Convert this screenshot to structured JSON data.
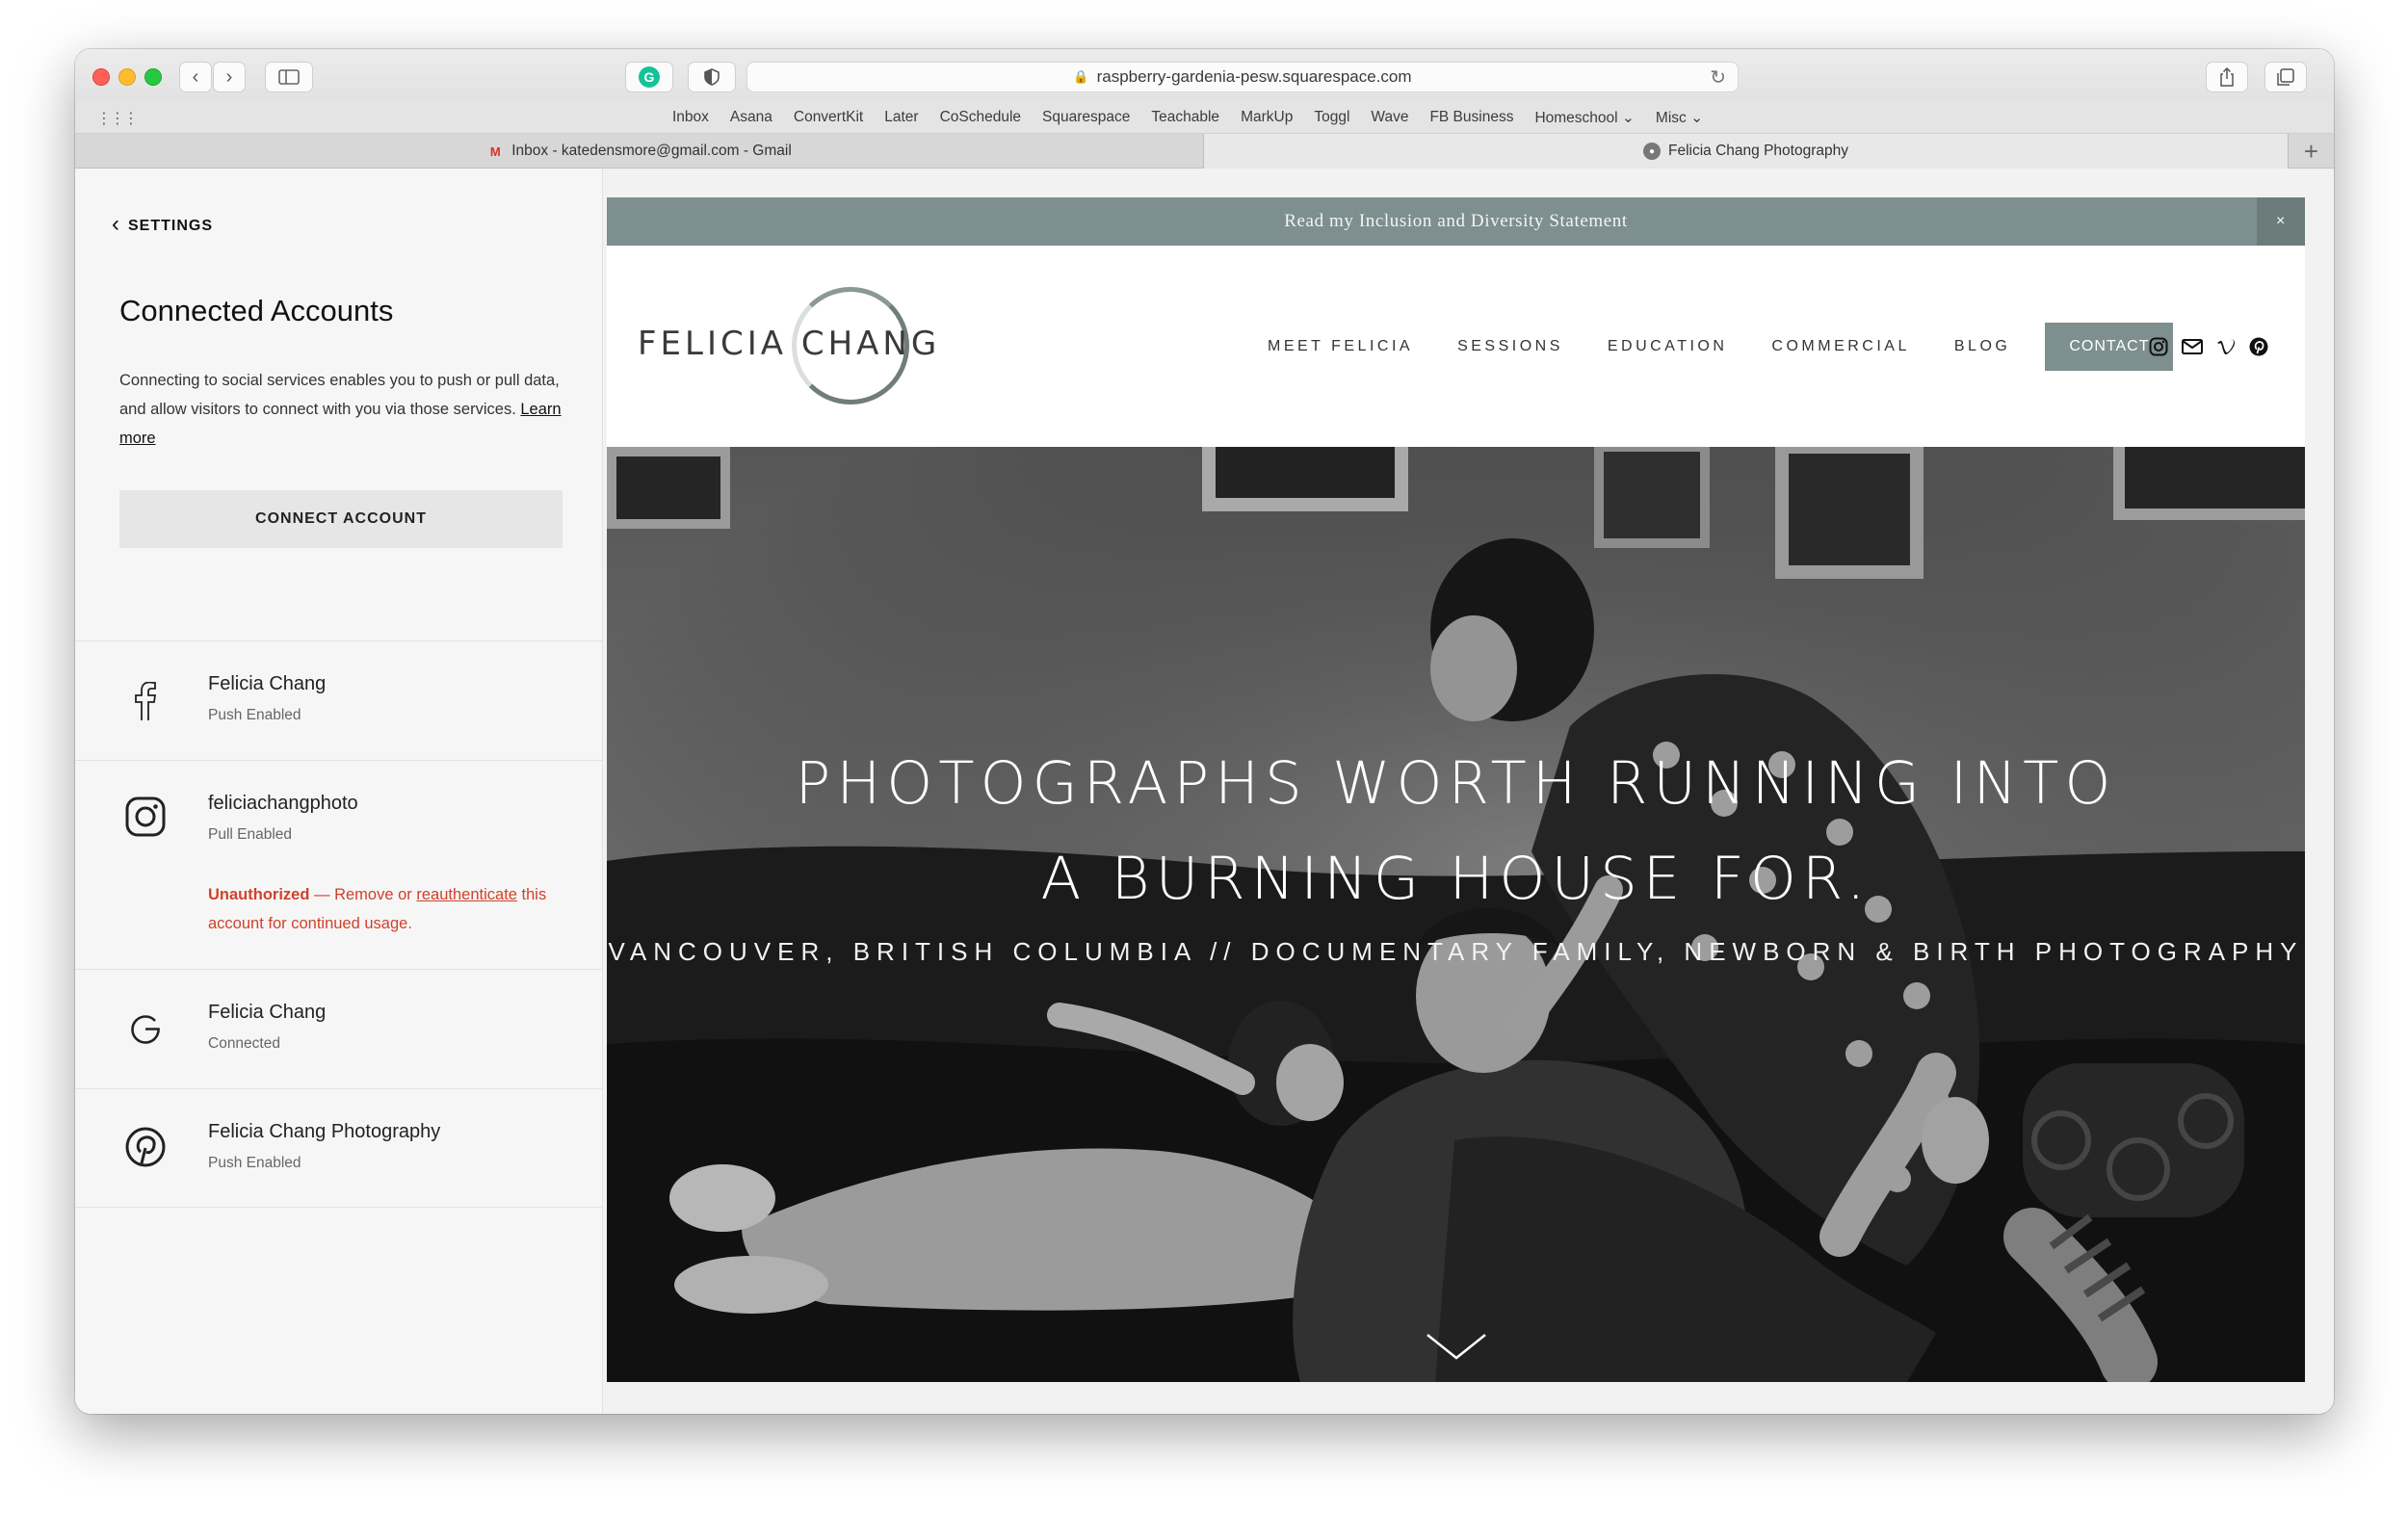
{
  "browser": {
    "url": "raspberry-gardenia-pesw.squarespace.com",
    "bookmarks": [
      "Inbox",
      "Asana",
      "ConvertKit",
      "Later",
      "CoSchedule",
      "Squarespace",
      "Teachable",
      "MarkUp",
      "Toggl",
      "Wave",
      "FB Business",
      "Homeschool ⌄",
      "Misc ⌄"
    ],
    "tabs": [
      {
        "title": "Inbox - katedensmore@gmail.com - Gmail",
        "favicon": "gmail-icon"
      },
      {
        "title": "Felicia Chang Photography",
        "favicon": "site-favicon"
      }
    ]
  },
  "sidebar": {
    "back_label": "SETTINGS",
    "title": "Connected Accounts",
    "description": "Connecting to social services enables you to push or pull data, and allow visitors to connect with you via those services.",
    "learn_more": "Learn more",
    "connect_button": "CONNECT ACCOUNT",
    "accounts": [
      {
        "icon": "facebook-icon",
        "name": "Felicia Chang",
        "status": "Push Enabled"
      },
      {
        "icon": "instagram-icon",
        "name": "feliciachangphoto",
        "status": "Pull Enabled",
        "warning_strong": "Unauthorized",
        "warning_text1": " — Remove or ",
        "warning_link": "reauthenticate",
        "warning_text2": " this account for continued usage."
      },
      {
        "icon": "google-icon",
        "name": "Felicia Chang",
        "status": "Connected"
      },
      {
        "icon": "pinterest-icon",
        "name": "Felicia Chang Photography",
        "status": "Push Enabled"
      }
    ]
  },
  "site": {
    "announcement": "Read my Inclusion and Diversity Statement",
    "close": "×",
    "logo_text": "FELICIA CHANG",
    "nav": [
      "MEET FELICIA",
      "SESSIONS",
      "EDUCATION",
      "COMMERCIAL",
      "BLOG"
    ],
    "contact": "CONTACT",
    "social_icons": [
      "instagram-icon",
      "mail-icon",
      "vimeo-icon",
      "pinterest-icon"
    ],
    "hero_line1": "PHOTOGRAPHS WORTH RUNNING INTO",
    "hero_line2": "A BURNING HOUSE FOR.",
    "hero_sub": "VANCOUVER, BRITISH COLUMBIA  // DOCUMENTARY FAMILY, NEWBORN & BIRTH PHOTOGRAPHY"
  },
  "colors": {
    "accent": "#7d8f8e",
    "warning": "#d2412a"
  }
}
